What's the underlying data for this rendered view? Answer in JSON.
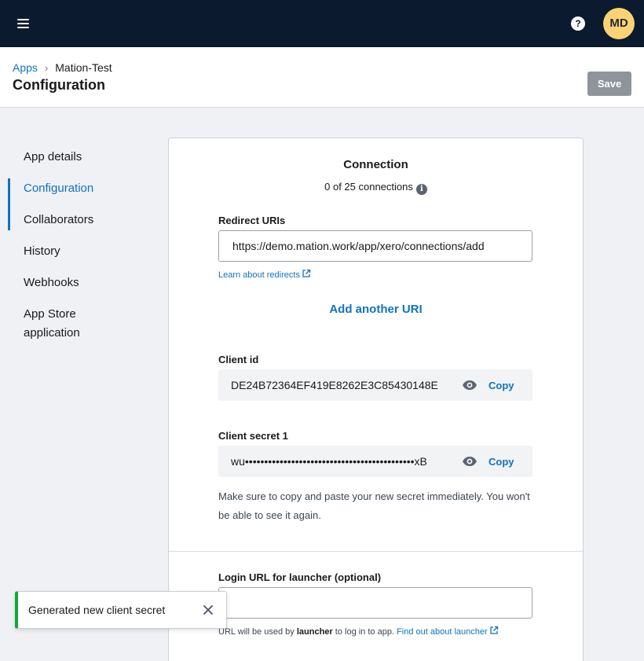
{
  "topbar": {
    "menu_icon": "hamburger-menu-icon",
    "help_icon": "question-circle-icon",
    "help_glyph": "?",
    "avatar_initials": "MD",
    "avatar_color": "#fcd374",
    "background_color": "#0b1a2e"
  },
  "header": {
    "breadcrumb": {
      "root": "Apps",
      "separator": "›",
      "current": "Mation-Test"
    },
    "title": "Configuration",
    "save_label": "Save"
  },
  "sidebar": {
    "items": [
      {
        "label": "App details",
        "active": false
      },
      {
        "label": "Configuration",
        "active": true
      },
      {
        "label": "Collaborators",
        "active": false
      },
      {
        "label": "History",
        "active": false
      },
      {
        "label": "Webhooks",
        "active": false
      },
      {
        "label": "App Store application",
        "active": false
      }
    ]
  },
  "connection": {
    "title": "Connection",
    "count_text": "0 of 25 connections",
    "info_icon": "info-circle-icon",
    "redirect_label": "Redirect URIs",
    "redirect_value": "https://demo.mation.work/app/xero/connections/add",
    "learn_redirects": "Learn about redirects",
    "add_uri": "Add another URI",
    "client_id_label": "Client id",
    "client_id_value": "DE24B72364EF419E8262E3C85430148E",
    "client_secret_label": "Client secret 1",
    "client_secret_value": "wu••••••••••••••••••••••••••••••••••••••••••••xB",
    "reveal_icon": "eye-icon",
    "copy_label": "Copy",
    "secret_note": "Make sure to copy and paste your new secret immediately. You won't be able to see it again."
  },
  "launcher": {
    "label": "Login URL for launcher (optional)",
    "value": "",
    "help_prefix": "URL will be used by ",
    "help_bold": "launcher",
    "help_middle": " to log in to app. ",
    "help_link": "Find out about launcher",
    "external_link_icon": "external-link-icon"
  },
  "toast": {
    "message": "Generated new client secret",
    "close_icon": "close-icon",
    "accent_color": "#13a538"
  },
  "colors": {
    "link": "#0f73c0",
    "page_background": "#eff1f4"
  }
}
